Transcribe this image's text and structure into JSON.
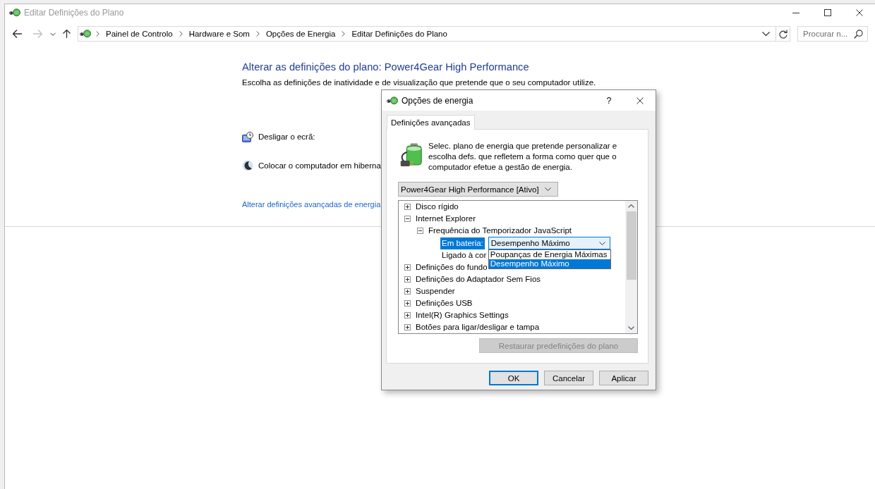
{
  "window": {
    "title": "Editar Definições do Plano",
    "active": false
  },
  "nav_buttons": [
    {
      "kind": "back",
      "disabled": false
    },
    {
      "kind": "forward",
      "disabled": true
    },
    {
      "kind": "recent",
      "disabled": false
    },
    {
      "kind": "up",
      "disabled": false
    }
  ],
  "address_bar": {
    "breadcrumbs": [
      "Painel de Controlo",
      "Hardware e Som",
      "Opções de Energia",
      "Editar Definições do Plano"
    ]
  },
  "search": {
    "placeholder": "Procurar n..."
  },
  "page": {
    "title": "Alterar as definições do plano: Power4Gear High Performance",
    "subtitle": "Escolha as definições de inatividade e de visualização que pretende que o seu computador utilize.",
    "settings": [
      {
        "kind": "display",
        "label": "Desligar o ecrã:"
      },
      {
        "kind": "sleep",
        "label": "Colocar o computador em hiberna"
      }
    ],
    "advanced_link": "Alterar definições avançadas de energia"
  },
  "dialog": {
    "title": "Opções de energia",
    "help": "?",
    "tabs": [
      {
        "label": "Definições avançadas",
        "selected": true
      }
    ],
    "description": "Selec. plano de energia que pretende personalizar e escolha defs. que refletem a forma como quer que o computador efetue a gestão de energia.",
    "plan": {
      "value": "Power4Gear High Performance [Ativo]"
    },
    "tree": [
      {
        "kind": "group",
        "label": "Disco rígido",
        "expanded": false,
        "selected": false
      },
      {
        "kind": "group",
        "label": "Internet Explorer",
        "expanded": true,
        "selected": false,
        "children": [
          {
            "kind": "group",
            "label": "Frequência do Temporizador JavaScript",
            "expanded": true,
            "selected": false,
            "children": [
              {
                "kind": "setting",
                "label": "Em bateria:",
                "selected": true,
                "value": "Desempenho Máximo",
                "expanded": true,
                "options": [
                  {
                    "label": "Poupanças de Energia Máximas",
                    "selected": false
                  },
                  {
                    "label": "Desempenho Máximo",
                    "selected": true
                  }
                ]
              },
              {
                "kind": "setting",
                "label": "Ligado à cor",
                "selected": false
              }
            ]
          }
        ]
      },
      {
        "kind": "group",
        "label": "Definições do fundo",
        "expanded": false,
        "selected": false
      },
      {
        "kind": "group",
        "label": "Definições do Adaptador Sem Fios",
        "expanded": false,
        "selected": false
      },
      {
        "kind": "group",
        "label": "Suspender",
        "expanded": false,
        "selected": false
      },
      {
        "kind": "group",
        "label": "Definições USB",
        "expanded": false,
        "selected": false
      },
      {
        "kind": "group",
        "label": "Intel(R) Graphics Settings",
        "expanded": false,
        "selected": false
      },
      {
        "kind": "group",
        "label": "Botões para ligar/desligar e tampa",
        "expanded": false,
        "selected": false
      }
    ],
    "restore_button": {
      "label": "Restaurar predefinições do plano",
      "disabled": true
    },
    "buttons": [
      {
        "label": "OK",
        "default": true
      },
      {
        "label": "Cancelar",
        "default": false
      },
      {
        "label": "Aplicar",
        "default": false
      }
    ]
  }
}
